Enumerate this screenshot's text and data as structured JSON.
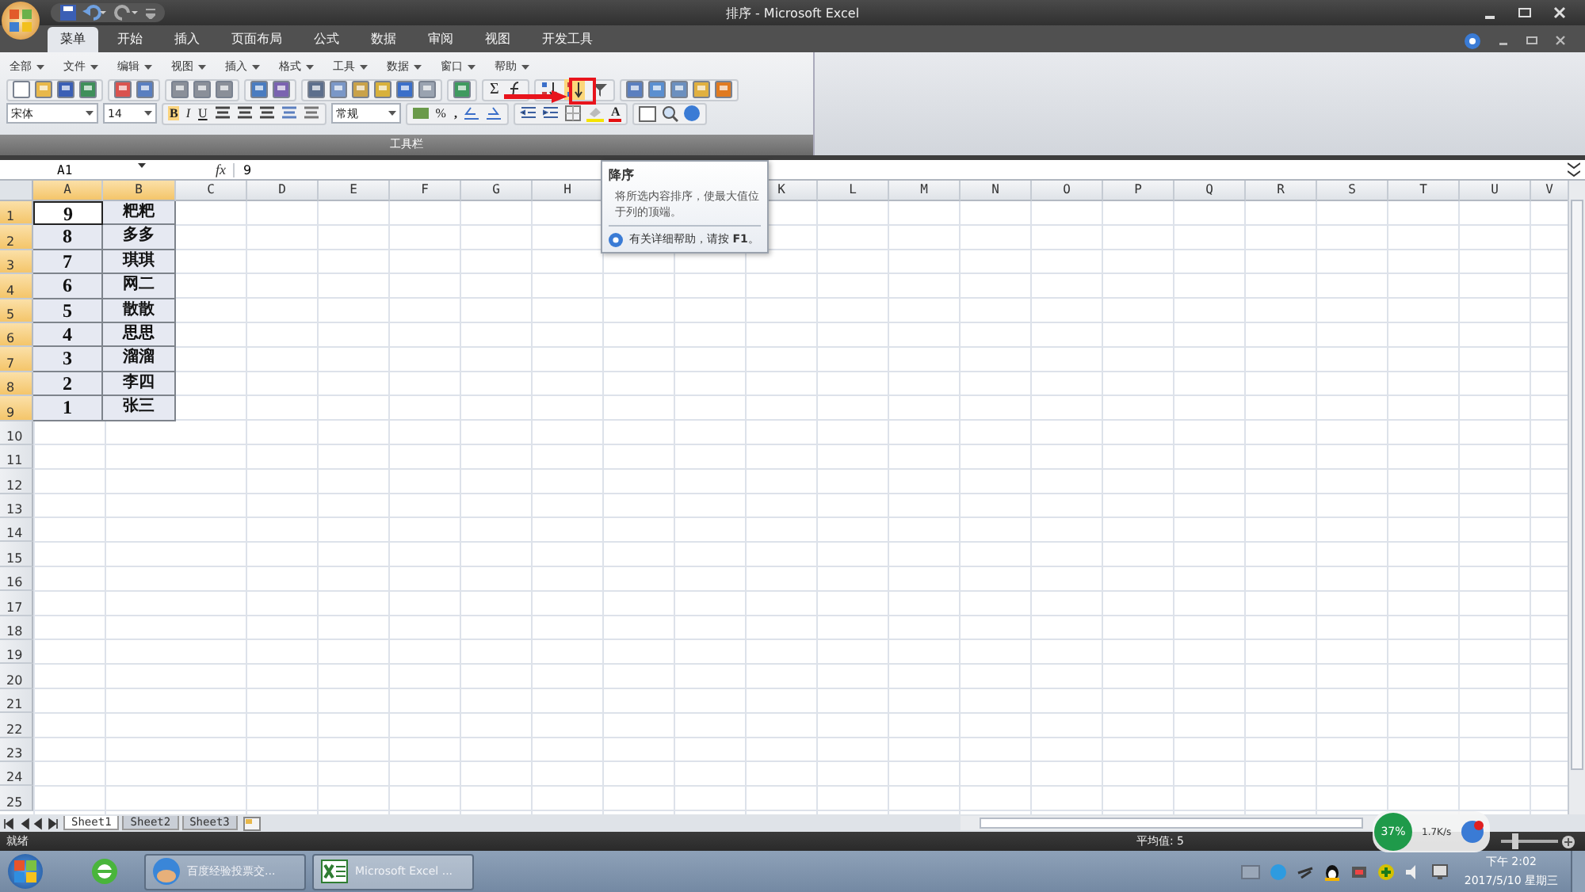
{
  "title_bar": {
    "title": "排序 - Microsoft Excel"
  },
  "ribbon_tabs": [
    {
      "label": "菜单",
      "selected": true
    },
    {
      "label": "开始",
      "selected": false
    },
    {
      "label": "插入",
      "selected": false
    },
    {
      "label": "页面布局",
      "selected": false
    },
    {
      "label": "公式",
      "selected": false
    },
    {
      "label": "数据",
      "selected": false
    },
    {
      "label": "审阅",
      "selected": false
    },
    {
      "label": "视图",
      "selected": false
    },
    {
      "label": "开发工具",
      "selected": false
    }
  ],
  "menu_bar": [
    "全部",
    "文件",
    "编辑",
    "视图",
    "插入",
    "格式",
    "工具",
    "数据",
    "窗口",
    "帮助"
  ],
  "toolbar": {
    "sum": "Σ",
    "font": "宋体",
    "size": "14",
    "bold": "B",
    "italic": "I",
    "underline": "U",
    "number_format": "常规",
    "percent": "%",
    "comma": ",",
    "font_color": "A",
    "group_label": "工具栏"
  },
  "formula_bar": {
    "name_box": "A1",
    "fx_label": "fx",
    "value": "9"
  },
  "columns": [
    {
      "label": "A",
      "selected": true
    },
    {
      "label": "B",
      "selected": true
    },
    {
      "label": "C",
      "selected": false
    },
    {
      "label": "D",
      "selected": false
    },
    {
      "label": "E",
      "selected": false
    },
    {
      "label": "F",
      "selected": false
    },
    {
      "label": "G",
      "selected": false
    },
    {
      "label": "H",
      "selected": false
    }
  ],
  "columns_right": [
    {
      "label": "K",
      "selected": false
    },
    {
      "label": "L",
      "selected": false
    },
    {
      "label": "M",
      "selected": false
    },
    {
      "label": "N",
      "selected": false
    },
    {
      "label": "O",
      "selected": false
    },
    {
      "label": "P",
      "selected": false
    },
    {
      "label": "Q",
      "selected": false
    },
    {
      "label": "R",
      "selected": false
    },
    {
      "label": "S",
      "selected": false
    },
    {
      "label": "T",
      "selected": false
    },
    {
      "label": "U",
      "selected": false
    },
    {
      "label": "V",
      "selected": false
    }
  ],
  "rows": [
    {
      "label": "1",
      "selected": true,
      "cells": [
        "9",
        "粑粑"
      ]
    },
    {
      "label": "2",
      "selected": true,
      "cells": [
        "8",
        "多多"
      ]
    },
    {
      "label": "3",
      "selected": true,
      "cells": [
        "7",
        "琪琪"
      ]
    },
    {
      "label": "4",
      "selected": true,
      "cells": [
        "6",
        "网二"
      ]
    },
    {
      "label": "5",
      "selected": true,
      "cells": [
        "5",
        "散散"
      ]
    },
    {
      "label": "6",
      "selected": true,
      "cells": [
        "4",
        "思思"
      ]
    },
    {
      "label": "7",
      "selected": true,
      "cells": [
        "3",
        "溜溜"
      ]
    },
    {
      "label": "8",
      "selected": true,
      "cells": [
        "2",
        "李四"
      ]
    },
    {
      "label": "9",
      "selected": true,
      "cells": [
        "1",
        "张三"
      ]
    },
    {
      "label": "10",
      "selected": false
    },
    {
      "label": "11",
      "selected": false
    },
    {
      "label": "12",
      "selected": false
    },
    {
      "label": "13",
      "selected": false
    },
    {
      "label": "14",
      "selected": false
    },
    {
      "label": "15",
      "selected": false
    },
    {
      "label": "16",
      "selected": false
    },
    {
      "label": "17",
      "selected": false
    },
    {
      "label": "18",
      "selected": false
    },
    {
      "label": "19",
      "selected": false
    },
    {
      "label": "20",
      "selected": false
    },
    {
      "label": "21",
      "selected": false
    },
    {
      "label": "22",
      "selected": false
    },
    {
      "label": "23",
      "selected": false
    },
    {
      "label": "24",
      "selected": false
    },
    {
      "label": "25",
      "selected": false
    }
  ],
  "tooltip": {
    "title": "降序",
    "description": "将所选内容排序，使最大值位于列的顶端。",
    "help": "有关详细帮助，请按 **F1**。"
  },
  "sheet_tabs": [
    {
      "label": "Sheet1",
      "selected": true
    },
    {
      "label": "Sheet2",
      "selected": false
    },
    {
      "label": "Sheet3",
      "selected": false
    }
  ],
  "status_bar": {
    "mode": "就绪",
    "average": "平均值: 5",
    "zoom": {
      "level": 0.25
    }
  },
  "net_widget": {
    "percent": "37%",
    "speed": "1.7K/s"
  },
  "taskbar": {
    "items": [
      {
        "label": "百度经验投票交...",
        "selected": false
      },
      {
        "label": "Microsoft Excel ...",
        "selected": true
      }
    ],
    "time": "下午 2:02",
    "date": "2017/5/10 星期三"
  }
}
